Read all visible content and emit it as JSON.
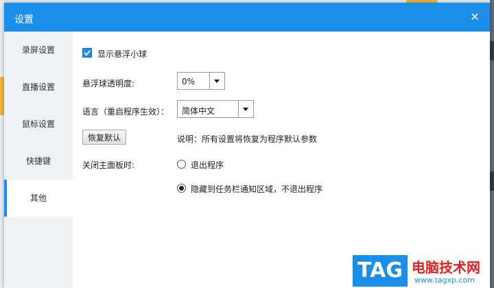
{
  "window": {
    "title": "设置",
    "close_glyph": "✕"
  },
  "sidebar": {
    "items": [
      {
        "label": "录屏设置"
      },
      {
        "label": "直播设置"
      },
      {
        "label": "鼠标设置"
      },
      {
        "label": "快捷键"
      },
      {
        "label": "其他"
      }
    ],
    "active_index": 4
  },
  "settings": {
    "show_float_ball": {
      "label": "显示悬浮小球",
      "checked": true
    },
    "float_opacity": {
      "label": "悬浮球透明度:",
      "value": "0%"
    },
    "language": {
      "label": "语言（重启程序生效）：",
      "value": "简体中文"
    },
    "restore": {
      "button": "恢复默认",
      "note": "说明：所有设置将恢复为程序默认参数"
    },
    "close_panel": {
      "label": "关闭主面板时:",
      "options": [
        {
          "label": "退出程序",
          "selected": false
        },
        {
          "label": "隐藏到任务栏通知区域，不退出程序",
          "selected": true
        }
      ]
    }
  },
  "watermark": {
    "badge": "TAG",
    "site_name": "电脑技术网",
    "url": "www.tagxp.com"
  },
  "colors": {
    "accent": "#1a8ee8",
    "sidebar_bg": "#eef2f5",
    "watermark_red": "#e02020"
  }
}
